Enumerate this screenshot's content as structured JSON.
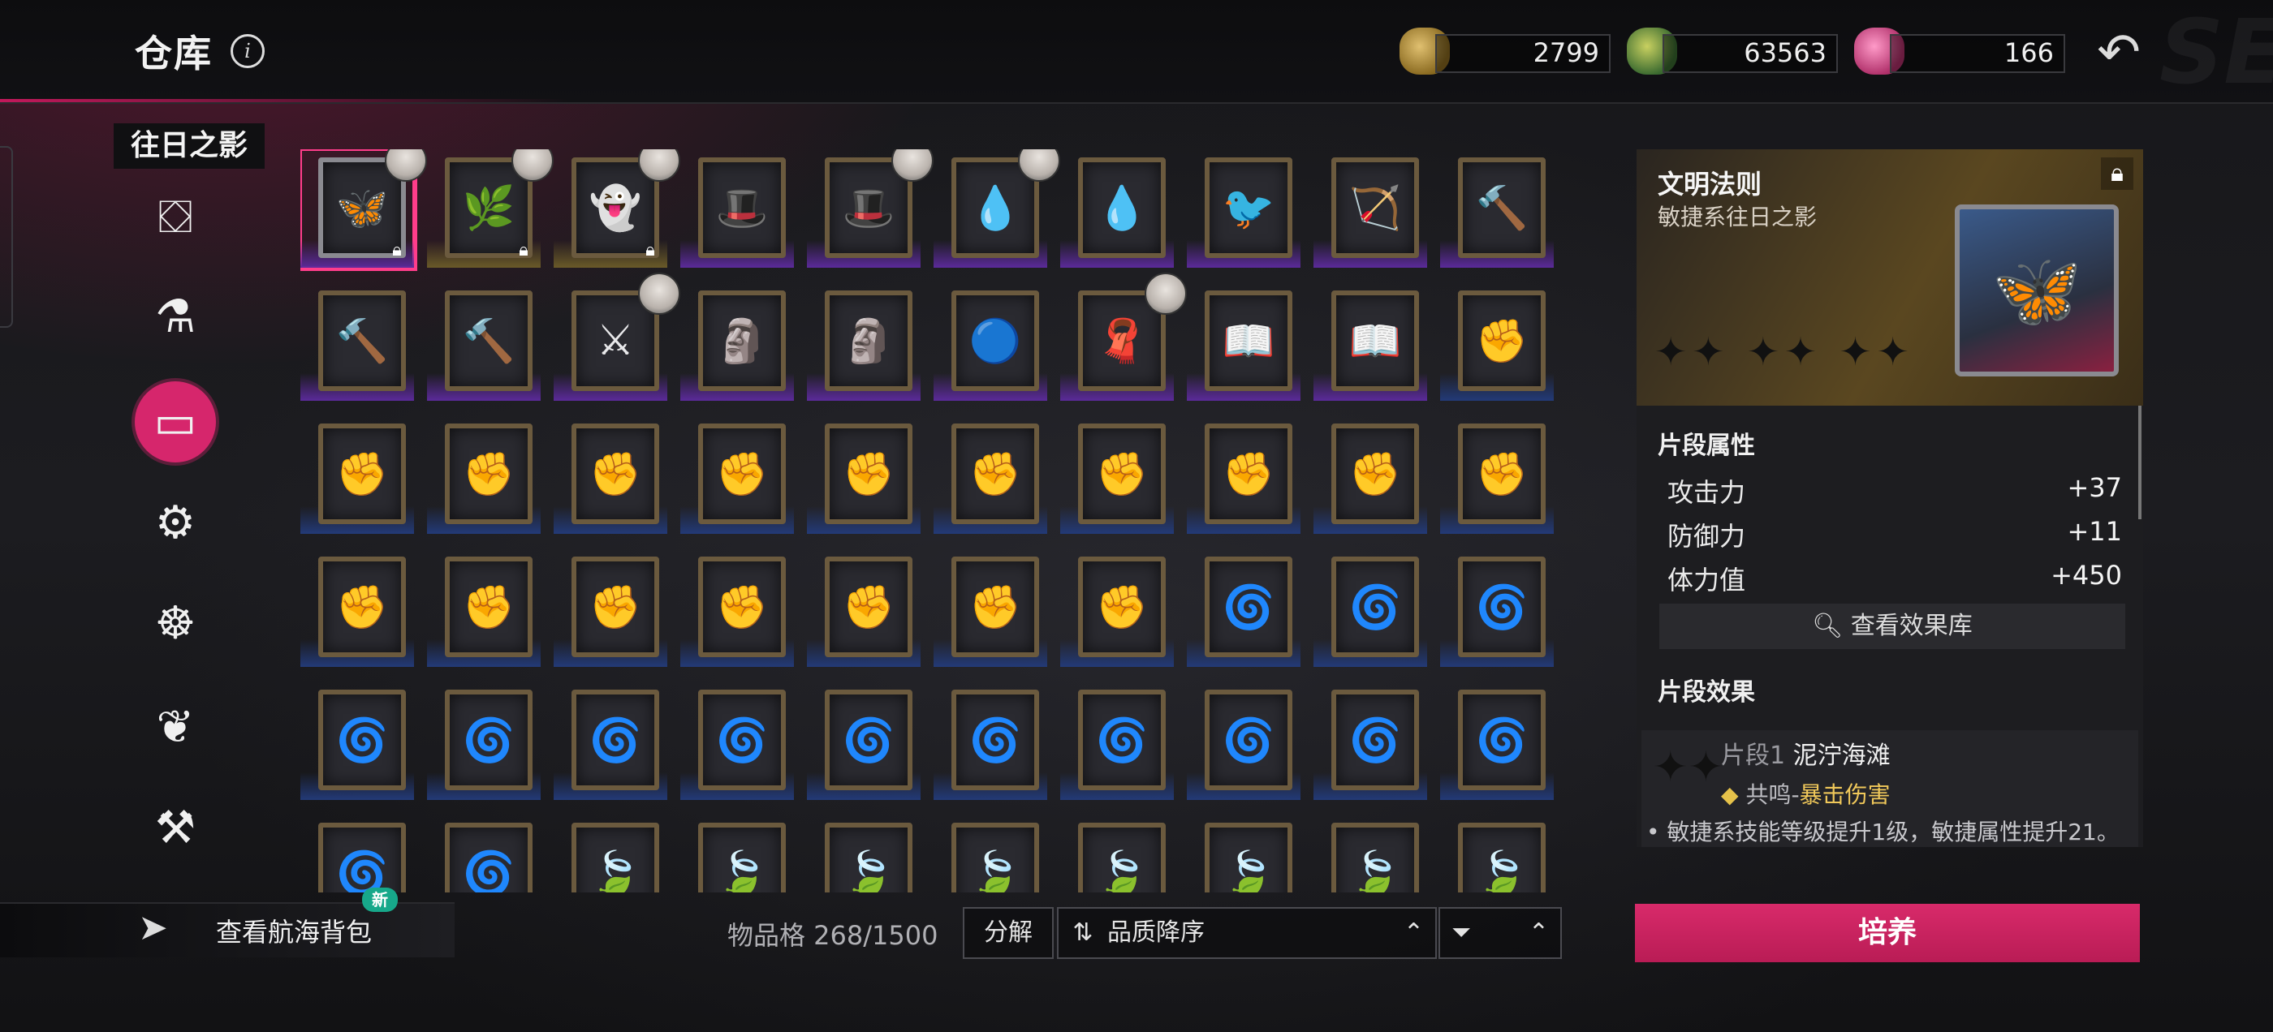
{
  "header": {
    "title": "仓库",
    "currencies": [
      {
        "icon": "gold-ore-icon",
        "value": "2799"
      },
      {
        "icon": "serpent-coin-icon",
        "value": "63563"
      },
      {
        "icon": "pink-gem-icon",
        "value": "166"
      }
    ]
  },
  "sidebar": {
    "category_label": "往日之影",
    "items": [
      {
        "name": "treasure-chest-icon",
        "glyph": "⛋"
      },
      {
        "name": "potion-bottle-icon",
        "glyph": "⚗"
      },
      {
        "name": "picture-frame-icon",
        "glyph": "▭"
      },
      {
        "name": "cog-icon",
        "glyph": "⚙"
      },
      {
        "name": "ship-wheel-icon",
        "glyph": "☸"
      },
      {
        "name": "herb-branch-icon",
        "glyph": "❦"
      },
      {
        "name": "shovel-icon",
        "glyph": "⚒"
      }
    ],
    "active_index": 2
  },
  "grid": {
    "items": [
      {
        "art": "🦋",
        "plate": "purple",
        "frame": "silver",
        "avatar": true,
        "lock": true,
        "selected": true
      },
      {
        "art": "🌿",
        "plate": "gold",
        "frame": "gold",
        "avatar": true,
        "lock": true
      },
      {
        "art": "👻",
        "plate": "gold",
        "frame": "gold",
        "avatar": true,
        "lock": true
      },
      {
        "art": "🎩",
        "plate": "purple",
        "frame": "gold",
        "avatar": false,
        "lock": false
      },
      {
        "art": "🎩",
        "plate": "purple",
        "frame": "gold",
        "avatar": true,
        "lock": false
      },
      {
        "art": "💧",
        "plate": "purple",
        "frame": "gold",
        "avatar": true,
        "lock": false
      },
      {
        "art": "💧",
        "plate": "purple",
        "frame": "gold",
        "avatar": false,
        "lock": false
      },
      {
        "art": "🐦",
        "plate": "purple",
        "frame": "gold",
        "avatar": false,
        "lock": false
      },
      {
        "art": "🏹",
        "plate": "purple",
        "frame": "gold",
        "avatar": false,
        "lock": false
      },
      {
        "art": "🔨",
        "plate": "purple",
        "frame": "gold",
        "avatar": false,
        "lock": false
      },
      {
        "art": "🔨",
        "plate": "purple",
        "frame": "gold",
        "avatar": false,
        "lock": false
      },
      {
        "art": "🔨",
        "plate": "purple",
        "frame": "gold",
        "avatar": false,
        "lock": false
      },
      {
        "art": "⚔",
        "plate": "purple",
        "frame": "gold",
        "avatar": true,
        "lock": false
      },
      {
        "art": "🗿",
        "plate": "purple",
        "frame": "gold",
        "avatar": false,
        "lock": false
      },
      {
        "art": "🗿",
        "plate": "purple",
        "frame": "gold",
        "avatar": false,
        "lock": false
      },
      {
        "art": "🔵",
        "plate": "purple",
        "frame": "gold",
        "avatar": false,
        "lock": false
      },
      {
        "art": "🧣",
        "plate": "purple",
        "frame": "gold",
        "avatar": true,
        "lock": false
      },
      {
        "art": "📖",
        "plate": "purple",
        "frame": "gold",
        "avatar": false,
        "lock": false
      },
      {
        "art": "📖",
        "plate": "purple",
        "frame": "gold",
        "avatar": false,
        "lock": false
      },
      {
        "art": "✊",
        "plate": "blue",
        "frame": "gold",
        "avatar": false,
        "lock": false
      },
      {
        "art": "✊",
        "plate": "blue",
        "frame": "gold"
      },
      {
        "art": "✊",
        "plate": "blue",
        "frame": "gold"
      },
      {
        "art": "✊",
        "plate": "blue",
        "frame": "gold"
      },
      {
        "art": "✊",
        "plate": "blue",
        "frame": "gold"
      },
      {
        "art": "✊",
        "plate": "blue",
        "frame": "gold"
      },
      {
        "art": "✊",
        "plate": "blue",
        "frame": "gold"
      },
      {
        "art": "✊",
        "plate": "blue",
        "frame": "gold"
      },
      {
        "art": "✊",
        "plate": "blue",
        "frame": "gold"
      },
      {
        "art": "✊",
        "plate": "blue",
        "frame": "gold"
      },
      {
        "art": "✊",
        "plate": "blue",
        "frame": "gold"
      },
      {
        "art": "✊",
        "plate": "blue",
        "frame": "gold"
      },
      {
        "art": "✊",
        "plate": "blue",
        "frame": "gold"
      },
      {
        "art": "✊",
        "plate": "blue",
        "frame": "gold"
      },
      {
        "art": "✊",
        "plate": "blue",
        "frame": "gold"
      },
      {
        "art": "✊",
        "plate": "blue",
        "frame": "gold"
      },
      {
        "art": "✊",
        "plate": "blue",
        "frame": "gold"
      },
      {
        "art": "✊",
        "plate": "blue",
        "frame": "gold"
      },
      {
        "art": "🌀",
        "plate": "blue",
        "frame": "gold"
      },
      {
        "art": "🌀",
        "plate": "blue",
        "frame": "gold"
      },
      {
        "art": "🌀",
        "plate": "blue",
        "frame": "gold"
      },
      {
        "art": "🌀",
        "plate": "blue",
        "frame": "gold"
      },
      {
        "art": "🌀",
        "plate": "blue",
        "frame": "gold"
      },
      {
        "art": "🌀",
        "plate": "blue",
        "frame": "gold"
      },
      {
        "art": "🌀",
        "plate": "blue",
        "frame": "gold"
      },
      {
        "art": "🌀",
        "plate": "blue",
        "frame": "gold"
      },
      {
        "art": "🌀",
        "plate": "blue",
        "frame": "gold"
      },
      {
        "art": "🌀",
        "plate": "blue",
        "frame": "gold"
      },
      {
        "art": "🌀",
        "plate": "blue",
        "frame": "gold"
      },
      {
        "art": "🌀",
        "plate": "blue",
        "frame": "gold"
      },
      {
        "art": "🌀",
        "plate": "blue",
        "frame": "gold"
      },
      {
        "art": "🌀",
        "plate": "blue",
        "frame": "gold"
      },
      {
        "art": "🌀",
        "plate": "blue",
        "frame": "gold"
      },
      {
        "art": "🍃",
        "plate": "blue",
        "frame": "gold"
      },
      {
        "art": "🍃",
        "plate": "blue",
        "frame": "gold"
      },
      {
        "art": "🍃",
        "plate": "blue",
        "frame": "gold"
      },
      {
        "art": "🍃",
        "plate": "blue",
        "frame": "gold"
      },
      {
        "art": "🍃",
        "plate": "blue",
        "frame": "gold"
      },
      {
        "art": "🍃",
        "plate": "blue",
        "frame": "gold"
      },
      {
        "art": "🍃",
        "plate": "blue",
        "frame": "gold"
      },
      {
        "art": "🍃",
        "plate": "blue",
        "frame": "gold"
      }
    ]
  },
  "footer": {
    "bag_label": "查看航海背包",
    "new_badge": "新",
    "slots": "物品格 268/1500",
    "decompose": "分解",
    "sort_label": "品质降序"
  },
  "detail": {
    "name": "文明法则",
    "type": "敏捷系往日之影",
    "stars": "✦✦ ✦✦ ✦✦",
    "attr_title": "片段属性",
    "attrs": [
      {
        "name": "攻击力",
        "value": "+37"
      },
      {
        "name": "防御力",
        "value": "+11"
      },
      {
        "name": "体力值",
        "value": "+450"
      }
    ],
    "view_lib": "查看效果库",
    "effect_title": "片段效果",
    "effect": {
      "level": "片段1",
      "name": "泥泞海滩",
      "resonance_label": "共鸣-",
      "resonance_value": "暴击伤害",
      "desc": "• 敏捷系技能等级提升1级，敏捷属性提升21。"
    },
    "train": "培养"
  },
  "colors": {
    "accent": "#d6266c",
    "plate_purple": "#5b2a9a",
    "plate_blue": "#233a78",
    "plate_gold": "#6a5a28"
  }
}
